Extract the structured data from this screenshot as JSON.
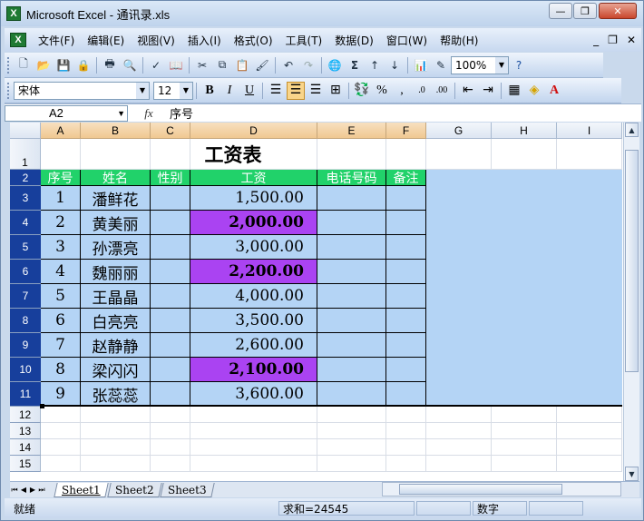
{
  "window": {
    "title": "Microsoft Excel - 通讯录.xls",
    "controls": [
      "—",
      "❐",
      "✕"
    ],
    "doc_controls": [
      "_",
      "❐",
      "✕"
    ]
  },
  "menu": [
    "文件(F)",
    "编辑(E)",
    "视图(V)",
    "插入(I)",
    "格式(O)",
    "工具(T)",
    "数据(D)",
    "窗口(W)",
    "帮助(H)"
  ],
  "toolbar": {
    "zoom": "100%",
    "font_name": "宋体",
    "font_size": "12",
    "bold": "B",
    "italic": "I",
    "underline": "U",
    "percent": "%",
    "comma": ",",
    "sum": "Σ"
  },
  "formula_bar": {
    "name_box": "A2",
    "fx": "fx",
    "value": "序号"
  },
  "columns": [
    "A",
    "B",
    "C",
    "D",
    "E",
    "F",
    "G",
    "H",
    "I"
  ],
  "rows": [
    "1",
    "2",
    "3",
    "4",
    "5",
    "6",
    "7",
    "8",
    "9",
    "10",
    "11",
    "12",
    "13",
    "14",
    "15"
  ],
  "sheet": {
    "title": "工资表",
    "headers": [
      "序号",
      "姓名",
      "性别",
      "工资",
      "电话号码",
      "备注"
    ],
    "records": [
      {
        "no": "1",
        "name": "潘鲜花",
        "gender": "",
        "salary": "1,500.00",
        "highlight": false
      },
      {
        "no": "2",
        "name": "黄美丽",
        "gender": "",
        "salary": "2,000.00",
        "highlight": true
      },
      {
        "no": "3",
        "name": "孙漂亮",
        "gender": "",
        "salary": "3,000.00",
        "highlight": false
      },
      {
        "no": "4",
        "name": "魏丽丽",
        "gender": "",
        "salary": "2,200.00",
        "highlight": true
      },
      {
        "no": "5",
        "name": "王晶晶",
        "gender": "",
        "salary": "4,000.00",
        "highlight": false
      },
      {
        "no": "6",
        "name": "白亮亮",
        "gender": "",
        "salary": "3,500.00",
        "highlight": false
      },
      {
        "no": "7",
        "name": "赵静静",
        "gender": "",
        "salary": "2,600.00",
        "highlight": false
      },
      {
        "no": "8",
        "name": "梁闪闪",
        "gender": "",
        "salary": "2,100.00",
        "highlight": true
      },
      {
        "no": "9",
        "name": "张蕊蕊",
        "gender": "",
        "salary": "3,600.00",
        "highlight": false
      }
    ]
  },
  "tabs": [
    "Sheet1",
    "Sheet2",
    "Sheet3"
  ],
  "status": {
    "ready": "就绪",
    "sum": "求和=24545",
    "mode": "数字"
  },
  "colors": {
    "header_green": "#21d26a",
    "highlight_purple": "#aa43f2",
    "selection_blue": "#b4d4f5",
    "row_header_selected": "#173f9c"
  }
}
